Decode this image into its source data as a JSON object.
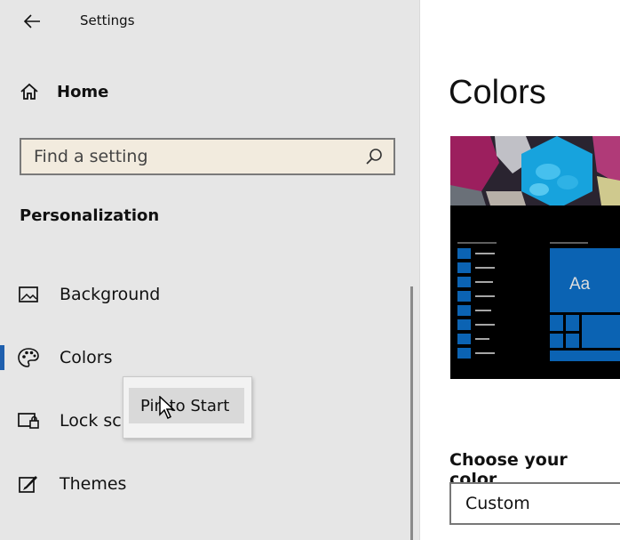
{
  "window": {
    "title": "Settings"
  },
  "sidebar": {
    "home_label": "Home",
    "search": {
      "placeholder": "Find a setting"
    },
    "section_title": "Personalization",
    "items": [
      {
        "label": "Background",
        "icon": "picture-icon"
      },
      {
        "label": "Colors",
        "icon": "palette-icon",
        "selected": true
      },
      {
        "label": "Lock sc",
        "icon": "lock-screen-icon"
      },
      {
        "label": "Themes",
        "icon": "themes-icon"
      }
    ]
  },
  "context_menu": {
    "item_label": "Pin to Start"
  },
  "main": {
    "title": "Colors",
    "preview": {
      "tile_text": "Aa"
    },
    "choose_color_label": "Choose your color",
    "choose_color_value": "Custom"
  },
  "colors": {
    "accent": "#1f5fae",
    "tile_blue": "#0b63b3",
    "sidebar_bg": "#e6e6e6"
  }
}
